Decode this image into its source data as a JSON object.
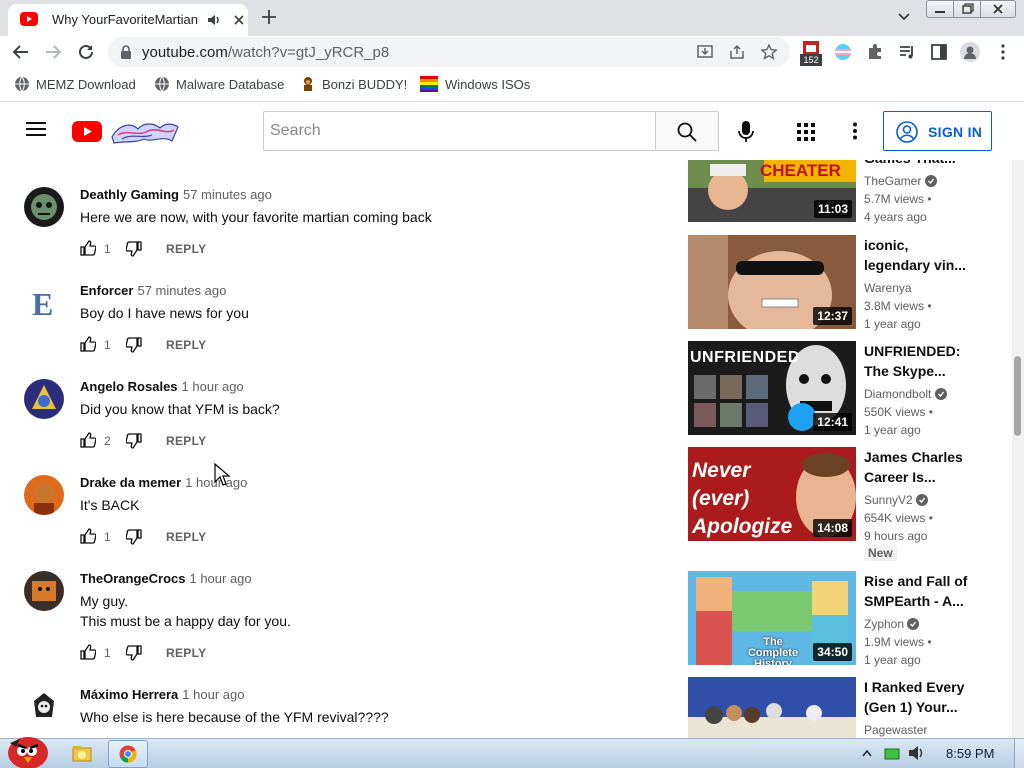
{
  "browser": {
    "tab_title": "Why YourFavoriteMartian",
    "url_host": "youtube.com",
    "url_path": "/watch?v=gtJ_yRCR_p8",
    "extension_badge": "152"
  },
  "bookmarks": [
    {
      "label": "MEMZ Download"
    },
    {
      "label": "Malware Database"
    },
    {
      "label": "Bonzi BUDDY!"
    },
    {
      "label": "Windows ISOs"
    }
  ],
  "masthead": {
    "search_placeholder": "Search",
    "sign_in_label": "SIGN IN"
  },
  "comments": [
    {
      "author": "Deathly Gaming",
      "time": "57 minutes ago",
      "lines": [
        "Here we are now, with your favorite martian coming back"
      ],
      "likes": "1",
      "reply": "REPLY"
    },
    {
      "author": "Enforcer",
      "time": "57 minutes ago",
      "lines": [
        "Boy do I have news for you"
      ],
      "likes": "1",
      "reply": "REPLY"
    },
    {
      "author": "Angelo Rosales",
      "time": "1 hour ago",
      "lines": [
        "Did you know that YFM is back?"
      ],
      "likes": "2",
      "reply": "REPLY"
    },
    {
      "author": "Drake da memer",
      "time": "1 hour ago",
      "lines": [
        "It's BACK"
      ],
      "likes": "1",
      "reply": "REPLY"
    },
    {
      "author": "TheOrangeCrocs",
      "time": "1 hour ago",
      "lines": [
        "My guy.",
        "This must be a happy day for you."
      ],
      "likes": "1",
      "reply": "REPLY"
    },
    {
      "author": "Máximo Herrera",
      "time": "1 hour ago",
      "lines": [
        "Who else is here because of the YFM revival????"
      ],
      "likes": "",
      "reply": ""
    }
  ],
  "recommendations": [
    {
      "title_lines": [
        "Games That..."
      ],
      "channel": "TheGamer",
      "verified": true,
      "views": "5.7M views •",
      "age": "4 years ago",
      "duration": "11:03",
      "thumb_text": "CHEATER"
    },
    {
      "title_lines": [
        "iconic,",
        "legendary vin..."
      ],
      "channel": "Warenya",
      "verified": false,
      "views": "3.8M views •",
      "age": "1 year ago",
      "duration": "12:37",
      "thumb_text": ""
    },
    {
      "title_lines": [
        "UNFRIENDED:",
        "The Skype..."
      ],
      "channel": "Diamondbolt",
      "verified": true,
      "views": "550K views •",
      "age": "1 year ago",
      "duration": "12:41",
      "thumb_text": "UNFRIENDED"
    },
    {
      "title_lines": [
        "James Charles",
        "Career Is..."
      ],
      "channel": "SunnyV2",
      "verified": true,
      "views": "654K views •",
      "age": "9 hours ago",
      "duration": "14:08",
      "thumb_text": "Never (ever) Apologize",
      "badge": "New"
    },
    {
      "title_lines": [
        "Rise and Fall of",
        "SMPEarth - A..."
      ],
      "channel": "Zyphon",
      "verified": true,
      "views": "1.9M views •",
      "age": "1 year ago",
      "duration": "34:50",
      "thumb_text": "The Complete History"
    },
    {
      "title_lines": [
        "I Ranked Every",
        "(Gen 1) Your..."
      ],
      "channel": "Pagewaster",
      "verified": false,
      "views": "",
      "age": "",
      "duration": "",
      "thumb_text": ""
    }
  ],
  "taskbar": {
    "clock": "8:59 PM"
  }
}
